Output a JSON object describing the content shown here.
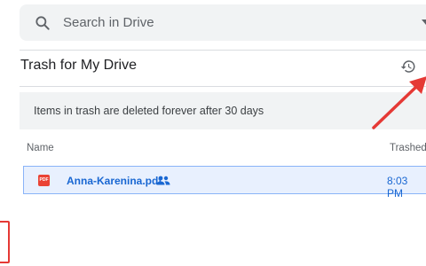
{
  "search": {
    "placeholder": "Search in Drive",
    "icon": "search-icon",
    "dropdown_icon": "caret-down-icon"
  },
  "page": {
    "title": "Trash for My Drive",
    "restore_icon": "restore-history-icon"
  },
  "notice": {
    "text": "Items in trash are deleted forever after 30 days"
  },
  "table": {
    "columns": [
      "Name",
      "Trashed"
    ],
    "rows": [
      {
        "name": "Anna-Karenina.pdf",
        "file_icon": "pdf-icon",
        "file_icon_label": "PDF",
        "shared_icon": "shared-people-icon",
        "trashed": "8:03 PM",
        "selected": true
      }
    ]
  },
  "colors": {
    "accent_blue": "#1967d2",
    "selection_bg": "#e8f0fe",
    "selection_border": "#8ab4f8",
    "pdf_red": "#ea4335",
    "annotation_red": "#e53935",
    "surface_gray": "#f1f3f4"
  }
}
